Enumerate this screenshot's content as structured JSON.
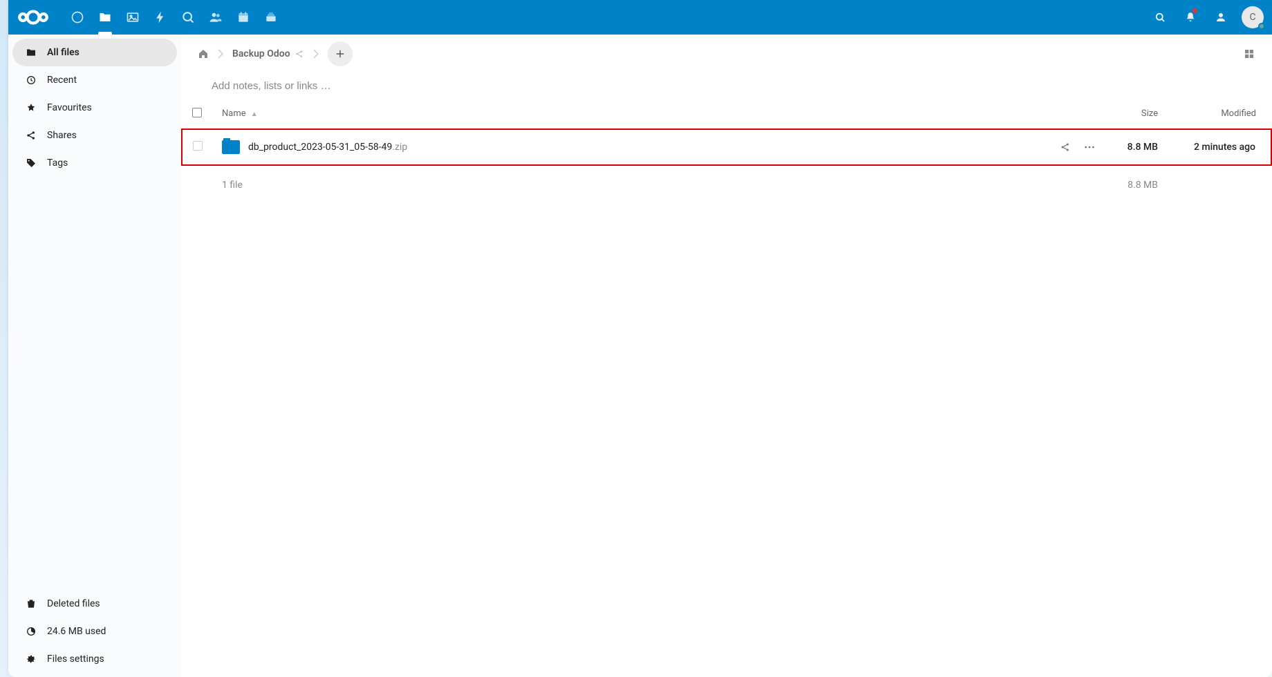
{
  "topbar": {
    "avatar_initial": "C",
    "notif_has_unread": true
  },
  "sidebar": {
    "nav": [
      {
        "label": "All files",
        "icon": "folder",
        "active": true
      },
      {
        "label": "Recent",
        "icon": "clock",
        "active": false
      },
      {
        "label": "Favourites",
        "icon": "star",
        "active": false
      },
      {
        "label": "Shares",
        "icon": "share",
        "active": false
      },
      {
        "label": "Tags",
        "icon": "tag",
        "active": false
      }
    ],
    "footer": [
      {
        "label": "Deleted files",
        "icon": "trash"
      },
      {
        "label": "24.6 MB used",
        "icon": "quota"
      },
      {
        "label": "Files settings",
        "icon": "gear"
      }
    ]
  },
  "breadcrumb": {
    "home_label": "Home",
    "current": "Backup Odoo"
  },
  "notes": {
    "placeholder": "Add notes, lists or links …"
  },
  "table": {
    "columns": {
      "name": "Name",
      "size": "Size",
      "modified": "Modified"
    },
    "rows": [
      {
        "name": "db_product_2023-05-31_05-58-49",
        "ext": ".zip",
        "size": "8.8 MB",
        "modified": "2 minutes ago",
        "highlight": true
      }
    ],
    "summary": {
      "count_label": "1 file",
      "total_size": "8.8 MB"
    }
  }
}
